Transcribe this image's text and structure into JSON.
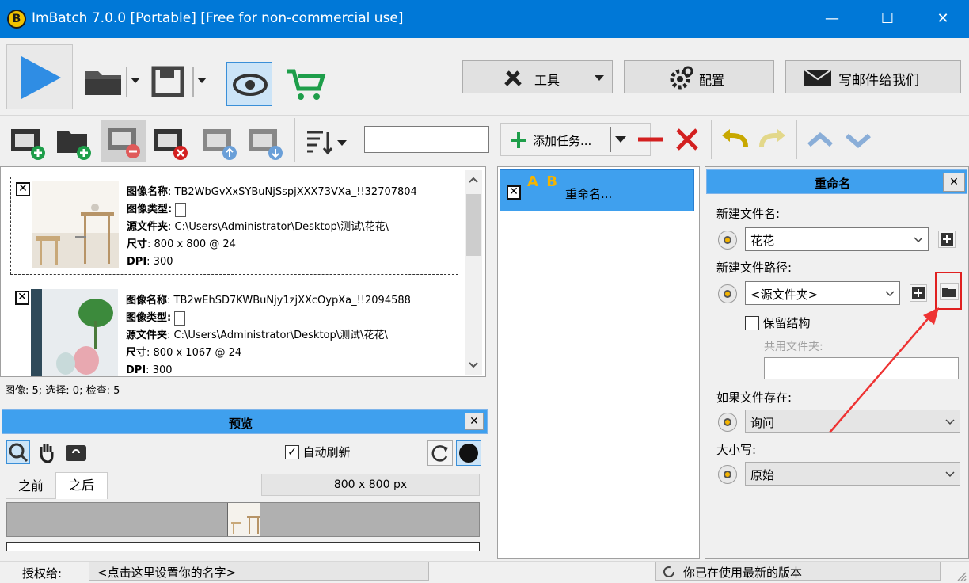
{
  "window": {
    "logo_letter": "B",
    "title": "ImBatch 7.0.0 [Portable] [Free for non-commercial use]",
    "minimize": "—",
    "maximize": "☐",
    "close": "✕"
  },
  "toolbar": {
    "tools_label": "工具",
    "config_label": "配置",
    "mail_label": "写邮件给我们"
  },
  "images": {
    "labels": {
      "name": "图像名称",
      "type": "图像类型",
      "folder": "源文件夹",
      "size": "尺寸",
      "dpi": "DPI"
    },
    "items": [
      {
        "name": ": TB2WbGvXxSYBuNjSspjXXX73VXa_!!32707804",
        "folder": ": C:\\Users\\Administrator\\Desktop\\测试\\花花\\",
        "size": ": 800 x 800 @ 24",
        "dpi": ": 300"
      },
      {
        "name": ": TB2wEhSD7KWBuNjy1zjXXcOypXa_!!2094588",
        "folder": ": C:\\Users\\Administrator\\Desktop\\测试\\花花\\",
        "size": ": 800 x 1067 @ 24",
        "dpi": ": 300"
      }
    ],
    "status": "图像: 5; 选择: 0; 检查: 5"
  },
  "preview": {
    "title": "预览",
    "auto_refresh": "自动刷新",
    "tab_before": "之前",
    "tab_after": "之后",
    "dimensions": "800 x 800 px"
  },
  "tasks": {
    "add_task": "添加任务...",
    "items": [
      {
        "label": "重命名...",
        "icon_text": "A B"
      }
    ]
  },
  "rename_panel": {
    "title": "重命名",
    "new_filename_label": "新建文件名:",
    "new_filename_value": "花花",
    "new_path_label": "新建文件路径:",
    "new_path_value": "<源文件夹>",
    "keep_structure": "保留结构",
    "shared_folder_label": "共用文件夹:",
    "shared_folder_value": "",
    "if_exists_label": "如果文件存在:",
    "if_exists_value": "询问",
    "case_label": "大小写:",
    "case_value": "原始"
  },
  "statusbar": {
    "license_label": "授权给:",
    "license_value": "<点击这里设置你的名字>",
    "version_status": "你已在使用最新的版本"
  },
  "colors": {
    "titlebar": "#0078d7",
    "selected_task": "#3fa0ee",
    "highlight_box": "#e02020",
    "arrow": "#e33"
  }
}
